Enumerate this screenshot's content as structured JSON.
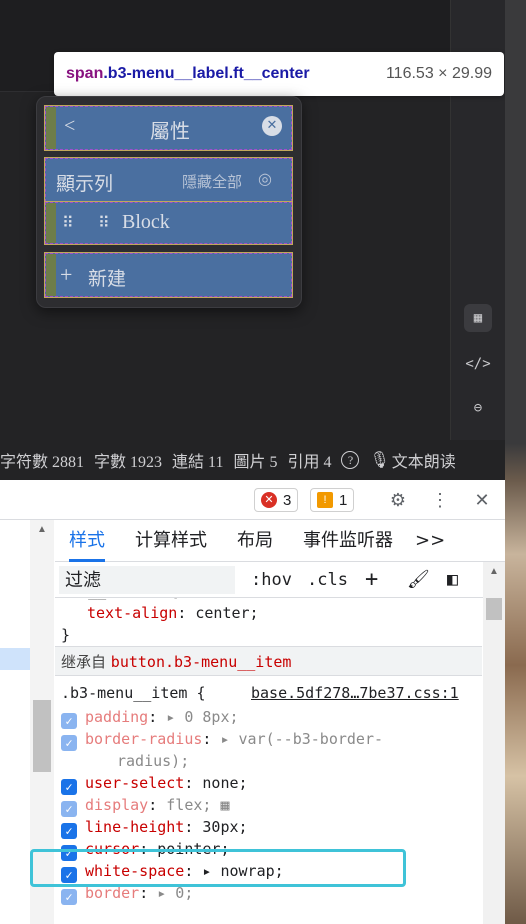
{
  "inspect_tooltip": {
    "tag": "span",
    "selector": ".b3-menu__label.ft__center",
    "dimensions": "116.53 × 29.99"
  },
  "popup": {
    "title": "屬性",
    "section": "顯示列",
    "hide_all": "隱藏全部",
    "block": "Block",
    "new": "新建"
  },
  "status_bar": {
    "chars": "字符數 2881",
    "words": "字數 1923",
    "links": "連結 11",
    "images": "圖片 5",
    "refs": "引用 4",
    "help": "?",
    "read_aloud": "文本朗读"
  },
  "devtools": {
    "errors": "3",
    "warnings": "1",
    "tabs": [
      "样式",
      "计算样式",
      "布局",
      "事件监听器",
      ">>"
    ],
    "filter_placeholder": "过滤",
    "hov": ":hov",
    "cls": ".cls",
    "add": "+",
    "inherited_label": "继承自",
    "inherited_source": "button.b3-menu__item",
    "rule_top": {
      "prop": "text-align",
      "value": "center;",
      "close": "}"
    },
    "rule": {
      "selector": ".b3-menu__item {",
      "source": "base.5df278…7be37.css:1",
      "props": [
        {
          "name": "padding",
          "value": "▸ 0 8px;",
          "enabled": false
        },
        {
          "name": "border-radius",
          "value": "▸ var(--b3-border-",
          "enabled": false
        },
        {
          "name": "",
          "value": "radius);",
          "enabled": false
        },
        {
          "name": "user-select",
          "value": "none;",
          "enabled": true
        },
        {
          "name": "display",
          "value": "flex;",
          "enabled": false
        },
        {
          "name": "line-height",
          "value": "30px;",
          "enabled": true
        },
        {
          "name": "cursor",
          "value": "pointer;",
          "enabled": true
        },
        {
          "name": "white-space",
          "value": "▸ nowrap;",
          "enabled": true
        },
        {
          "name": "border",
          "value": "▸ 0;",
          "enabled": false
        }
      ]
    }
  }
}
